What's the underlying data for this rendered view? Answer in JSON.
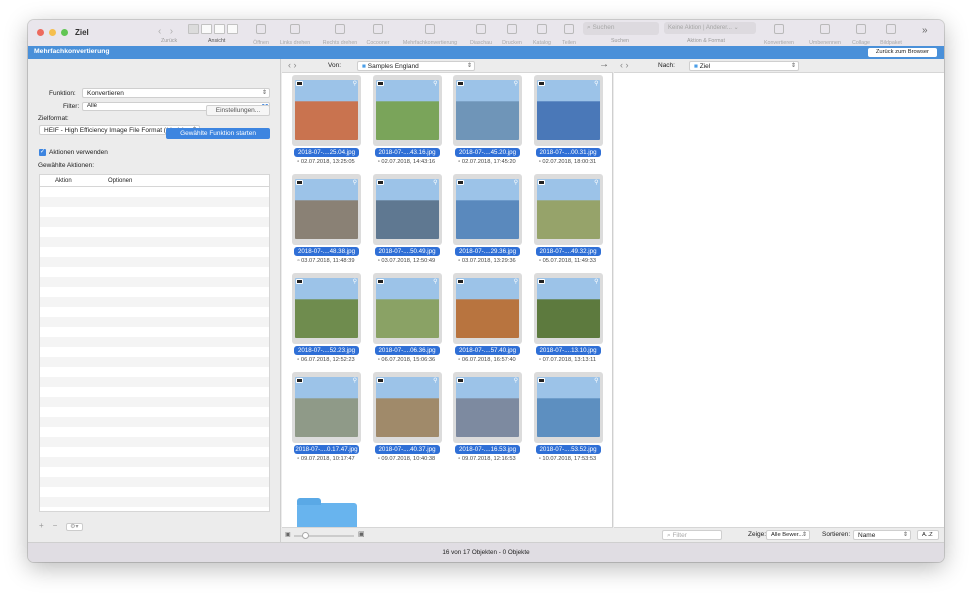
{
  "window": {
    "title": "Ziel",
    "nav_back": "‹",
    "nav_fwd": "›"
  },
  "toolbar": {
    "zurueck": "Zurück",
    "ansicht": "Ansicht",
    "oeffnen": "Öffnen",
    "links_drehen": "Links drehen",
    "rechts_drehen": "Rechts drehen",
    "cocooner": "Cocooner",
    "mehrfach": "Mehrfachkonvertierung",
    "diaschau": "Diaschau",
    "drucken": "Drucken",
    "katalog": "Katalog",
    "teilen": "Teilen",
    "suchen_placeholder": "Suchen",
    "suchen": "Suchen",
    "aktion_select": "Keine Aktion | Anderer...",
    "aktion_format": "Aktion & Format",
    "konvertieren": "Konvertieren",
    "umbenennen": "Umbenennen",
    "collage": "Collage",
    "bildpaket": "Bildpaket",
    "more": "»"
  },
  "bar": {
    "title": "Mehrfachkonvertierung",
    "back_button": "Zurück zum Browser"
  },
  "left": {
    "funktion_label": "Funktion:",
    "funktion_value": "Konvertieren",
    "filter_label": "Filter:",
    "filter_value": "Alle",
    "zielformat_label": "Zielformat:",
    "zielformat_value": "HEIF - High Efficiency Image File Format (*.heic)",
    "einstellungen": "Einstellungen...",
    "start_button": "Gewählte Funktion starten",
    "aktionen_verwenden": "Aktionen verwenden",
    "gewaehlte_aktionen": "Gewählte Aktionen:",
    "col_aktion": "Aktion",
    "col_optionen": "Optionen",
    "add": "+",
    "remove": "−",
    "gear": "⚙▾"
  },
  "middle": {
    "von_label": "Von:",
    "folder": "Samples England",
    "arrow": "→"
  },
  "right": {
    "nach_label": "Nach:",
    "folder": "Ziel",
    "filter_placeholder": "Filter",
    "zeige_label": "Zeige:",
    "zeige_value": "Alle Bewer...",
    "sortieren_label": "Sortieren:",
    "sort_value": "Name",
    "order_value": "A..Z"
  },
  "files": [
    {
      "name": "2018-07-....25.04.jpg",
      "date": "02.07.2018, 13:25:05",
      "color": "#c9734f"
    },
    {
      "name": "2018-07-....43.16.jpg",
      "date": "02.07.2018, 14:43:16",
      "color": "#7aa45a"
    },
    {
      "name": "2018-07-....45.20.jpg",
      "date": "02.07.2018, 17:45:20",
      "color": "#6f95b8"
    },
    {
      "name": "2018-07-....00.31.jpg",
      "date": "02.07.2018, 18:00:31",
      "color": "#4a78b8"
    },
    {
      "name": "2018-07-....48.38.jpg",
      "date": "03.07.2018, 11:48:39",
      "color": "#8a8175"
    },
    {
      "name": "2018-07-....50.49.jpg",
      "date": "03.07.2018, 12:50:49",
      "color": "#5f7891"
    },
    {
      "name": "2018-07-....29.36.jpg",
      "date": "03.07.2018, 13:29:36",
      "color": "#5a89bd"
    },
    {
      "name": "2018-07-....49.32.jpg",
      "date": "05.07.2018, 11:49:33",
      "color": "#96a36a"
    },
    {
      "name": "2018-07-....52.23.jpg",
      "date": "06.07.2018, 12:52:23",
      "color": "#6f8c4e"
    },
    {
      "name": "2018-07-....06.36.jpg",
      "date": "06.07.2018, 15:06:36",
      "color": "#8aa265"
    },
    {
      "name": "2018-07-....57.40.jpg",
      "date": "06.07.2018, 16:57:40",
      "color": "#b8743f"
    },
    {
      "name": "2018-07-....13.10.jpg",
      "date": "07.07.2018, 13:13:11",
      "color": "#5d7a3e"
    },
    {
      "name": "2018-07-....0.17.47.jpg",
      "date": "09.07.2018, 10:17:47",
      "color": "#8f9a88"
    },
    {
      "name": "2018-07-....40.37.jpg",
      "date": "09.07.2018, 10:40:38",
      "color": "#a08a6a"
    },
    {
      "name": "2018-07-....16.53.jpg",
      "date": "09.07.2018, 12:16:53",
      "color": "#7d8aa0"
    },
    {
      "name": "2018-07-....53.52.jpg",
      "date": "10.07.2018, 17:53:53",
      "color": "#5d8fc0"
    }
  ],
  "status": "16 von 17 Objekten - 0 Objekte",
  "colors": {
    "accent": "#3d85e0",
    "bar": "#4a90d9",
    "label": "#2f6fd6"
  }
}
